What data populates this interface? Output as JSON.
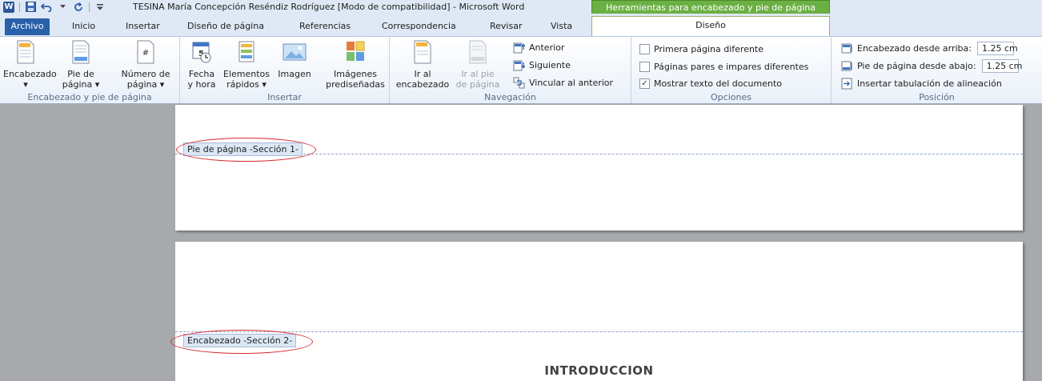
{
  "window": {
    "logo": "W",
    "title": "TESINA María Concepción Reséndiz Rodríguez [Modo de compatibilidad] - Microsoft Word",
    "contextual_title": "Herramientas para encabezado y pie de página"
  },
  "tabs": {
    "archivo": "Archivo",
    "inicio": "Inicio",
    "insertar": "Insertar",
    "diseno_pagina": "Diseño de página",
    "referencias": "Referencias",
    "correspondencia": "Correspondencia",
    "revisar": "Revisar",
    "vista": "Vista",
    "diseno": "Diseño"
  },
  "ribbon": {
    "g1": {
      "label": "Encabezado y pie de página",
      "encabezado": [
        "Encabezado",
        "▾"
      ],
      "pie": [
        "Pie de",
        "página ▾"
      ],
      "numero": [
        "Número de",
        "página ▾"
      ]
    },
    "g2": {
      "label": "Insertar",
      "fecha": [
        "Fecha",
        "y hora"
      ],
      "elementos": [
        "Elementos",
        "rápidos ▾"
      ],
      "imagen": [
        "Imagen",
        ""
      ],
      "imagenes": [
        "Imágenes",
        "prediseñadas"
      ]
    },
    "g3": {
      "label": "Navegación",
      "ir_enc": [
        "Ir al",
        "encabezado"
      ],
      "ir_pie": [
        "Ir al pie",
        "de página"
      ],
      "anterior": "Anterior",
      "siguiente": "Siguiente",
      "vincular": "Vincular al anterior"
    },
    "g4": {
      "label": "Opciones",
      "primera": "Primera página diferente",
      "pares": "Páginas pares e impares diferentes",
      "mostrar": "Mostrar texto del documento"
    },
    "g5": {
      "label": "Posición",
      "enc_arriba": "Encabezado desde arriba:",
      "enc_arriba_val": "1.25 cm",
      "pie_abajo": "Pie de página desde abajo:",
      "pie_abajo_val": "1.25 cm",
      "tabulacion": "Insertar tabulación de alineación"
    }
  },
  "document": {
    "footer_tag": "Pie de página -Sección 1-",
    "header_tag": "Encabezado -Sección 2-",
    "heading": "INTRODUCCION"
  },
  "options_state": {
    "primera": false,
    "pares": false,
    "mostrar": true
  },
  "colors": {
    "archivo_tab": "#2a5faa",
    "contextual": "#6bb043",
    "annotation": "#d8282d"
  }
}
